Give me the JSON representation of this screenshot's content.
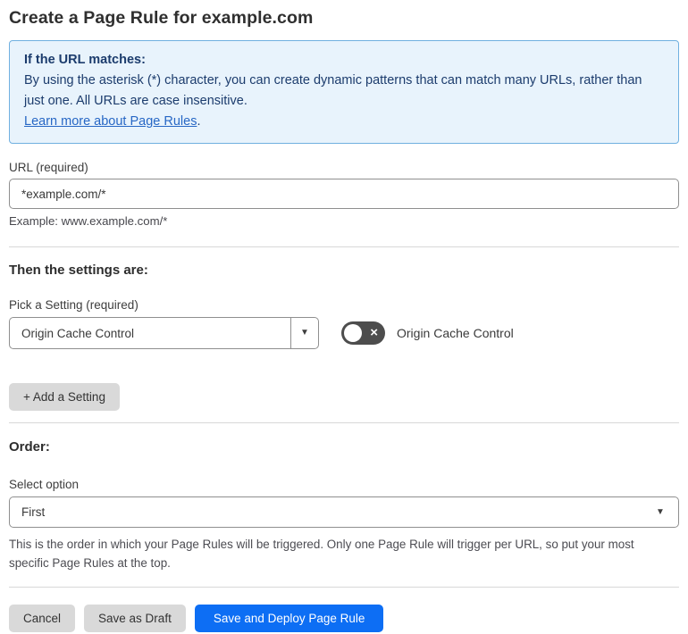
{
  "page": {
    "title": "Create a Page Rule for example.com"
  },
  "info_box": {
    "heading": "If the URL matches:",
    "body": "By using the asterisk (*) character, you can create dynamic patterns that can match many URLs, rather than just one. All URLs are case insensitive.",
    "link": "Learn more about Page Rules",
    "link_suffix": "."
  },
  "url_section": {
    "label": "URL (required)",
    "value": "*example.com/*",
    "example": "Example: www.example.com/*"
  },
  "settings_section": {
    "heading": "Then the settings are:",
    "picker_label": "Pick a Setting (required)",
    "picker_value": "Origin Cache Control",
    "toggle_label": "Origin Cache Control",
    "toggle_state": "off",
    "toggle_off_glyph": "×",
    "add_button": "+ Add a Setting"
  },
  "order_section": {
    "heading": "Order:",
    "label": "Select option",
    "value": "First",
    "help": "This is the order in which your Page Rules will be triggered. Only one Page Rule will trigger per URL, so put your most specific Page Rules at the top."
  },
  "footer": {
    "cancel": "Cancel",
    "save_draft": "Save as Draft",
    "save_deploy": "Save and Deploy Page Rule"
  },
  "icons": {
    "dropdown_caret": "▼"
  },
  "colors": {
    "accent_blue": "#0d6ef4",
    "info_bg": "#e8f3fc",
    "info_border": "#70b0e0",
    "info_text": "#1c3c6d",
    "link_blue": "#2767c5",
    "button_gray": "#d9d9d9",
    "toggle_off_bg": "#4d4d4d"
  }
}
